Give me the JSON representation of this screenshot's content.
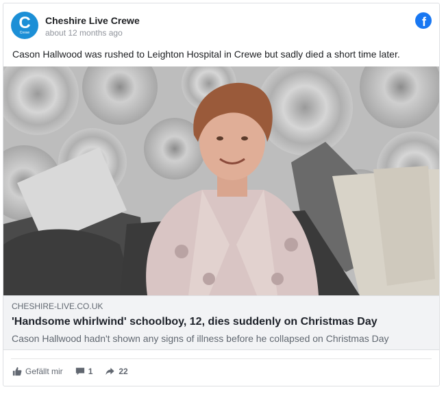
{
  "post": {
    "page_name": "Cheshire Live Crewe",
    "avatar_letter": "C",
    "avatar_sub": "Crewe",
    "timestamp": "about 12 months ago",
    "text": "Cason Hallwood was rushed to Leighton Hospital in Crewe but sadly died a short time later.",
    "platform_icon": "facebook-icon",
    "brand_color": "#1877f2"
  },
  "link": {
    "domain": "CHESHIRE-LIVE.CO.UK",
    "title": "'Handsome whirlwind' schoolboy, 12, dies suddenly on Christmas Day",
    "description": "Cason Hallwood hadn't shown any signs of illness before he collapsed on Christmas Day"
  },
  "actions": {
    "like_label": "Gefällt mir",
    "comment_count": "1",
    "share_count": "22"
  }
}
